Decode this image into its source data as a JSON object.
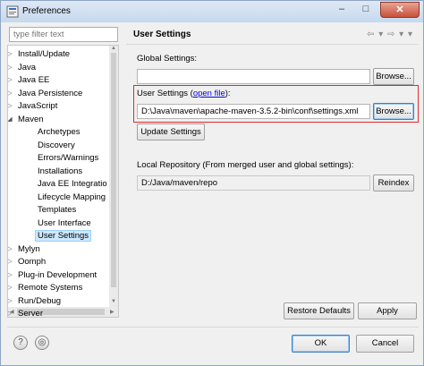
{
  "window": {
    "title": "Preferences",
    "controls": {
      "minimize": "–",
      "maximize": "□",
      "close": "✕"
    }
  },
  "filter": {
    "placeholder": "type filter text"
  },
  "tree": {
    "items": [
      {
        "label": "Install/Update",
        "arrow": "collapsed",
        "level": 0
      },
      {
        "label": "Java",
        "arrow": "collapsed",
        "level": 0
      },
      {
        "label": "Java EE",
        "arrow": "collapsed",
        "level": 0
      },
      {
        "label": "Java Persistence",
        "arrow": "collapsed",
        "level": 0
      },
      {
        "label": "JavaScript",
        "arrow": "collapsed",
        "level": 0
      },
      {
        "label": "Maven",
        "arrow": "expanded",
        "level": 0
      },
      {
        "label": "Archetypes",
        "arrow": "none",
        "level": 1
      },
      {
        "label": "Discovery",
        "arrow": "none",
        "level": 1
      },
      {
        "label": "Errors/Warnings",
        "arrow": "none",
        "level": 1
      },
      {
        "label": "Installations",
        "arrow": "none",
        "level": 1
      },
      {
        "label": "Java EE Integratio",
        "arrow": "none",
        "level": 1
      },
      {
        "label": "Lifecycle Mapping",
        "arrow": "none",
        "level": 1
      },
      {
        "label": "Templates",
        "arrow": "none",
        "level": 1
      },
      {
        "label": "User Interface",
        "arrow": "none",
        "level": 1
      },
      {
        "label": "User Settings",
        "arrow": "none",
        "level": 1,
        "selected": true
      },
      {
        "label": "Mylyn",
        "arrow": "collapsed",
        "level": 0
      },
      {
        "label": "Oomph",
        "arrow": "collapsed",
        "level": 0
      },
      {
        "label": "Plug-in Development",
        "arrow": "collapsed",
        "level": 0
      },
      {
        "label": "Remote Systems",
        "arrow": "collapsed",
        "level": 0
      },
      {
        "label": "Run/Debug",
        "arrow": "collapsed",
        "level": 0
      },
      {
        "label": "Server",
        "arrow": "collapsed",
        "level": 0
      }
    ]
  },
  "page": {
    "title": "User Settings",
    "nav_icons": "⇦ ▾ ⇨ ▾ ▾",
    "global_settings": {
      "label": "Global Settings:",
      "value": "",
      "browse": "Browse..."
    },
    "user_settings": {
      "label_prefix": "User Settings (",
      "link": "open file",
      "label_suffix": "):",
      "value": "D:\\Java\\maven\\apache-maven-3.5.2-bin\\conf\\settings.xml",
      "browse": "Browse..."
    },
    "update_button": "Update Settings",
    "local_repo": {
      "label": "Local Repository (From merged user and global settings):",
      "value": "D:/Java/maven/repo",
      "reindex": "Reindex"
    },
    "restore_defaults": "Restore Defaults",
    "apply": "Apply"
  },
  "footer": {
    "ok": "OK",
    "cancel": "Cancel"
  },
  "colors": {
    "highlight_box": "#e02b2b",
    "selection": "#cde8ff",
    "link": "#0000ee"
  }
}
